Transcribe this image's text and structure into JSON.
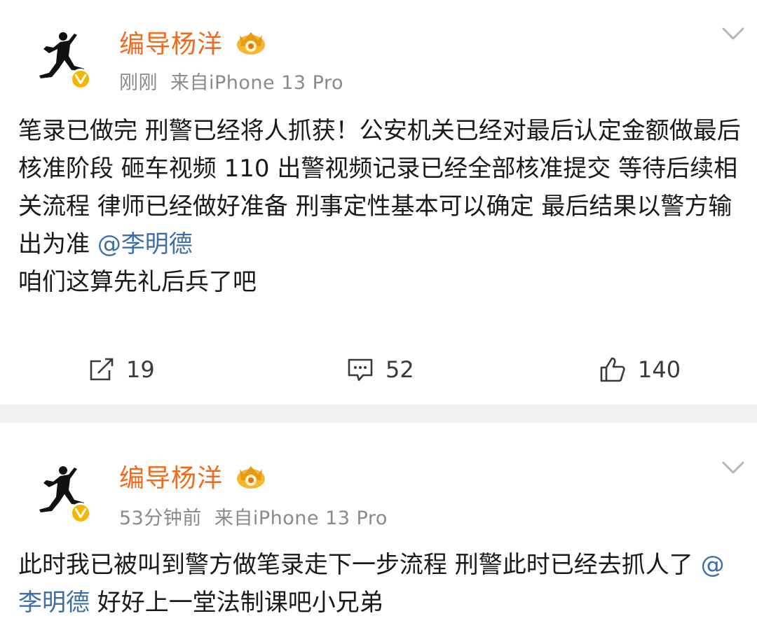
{
  "posts": [
    {
      "author": "编导杨洋",
      "time": "刚刚",
      "source": "来自iPhone 13 Pro",
      "content_before": "笔录已做完 刑警已经将人抓获！公安机关已经对最后认定金额做最后核准阶段 砸车视频 110 出警视频记录已经全部核准提交  等待后续相关流程 律师已经做好准备 刑事定性基本可以确定 最后结果以警方输出为准 ",
      "mention": "@李明德",
      "content_after": "咱们这算先礼后兵了吧",
      "repost_count": "19",
      "comment_count": "52",
      "like_count": "140"
    },
    {
      "author": "编导杨洋",
      "time": "53分钟前",
      "source": "来自iPhone 13 Pro",
      "content_before": "此时我已被叫到警方做笔录走下一步流程 刑警此时已经去抓人了 ",
      "mention": "@李明德",
      "content_after": " 好好上一堂法制课吧小兄弟"
    }
  ],
  "colors": {
    "username": "#f26a1b",
    "mention": "#3e6ea8",
    "verified_badge": "#f7b500",
    "meta": "#8a8a8a",
    "divider": "#f1f1f1"
  },
  "icons": {
    "avatar": "jumpman-logo-icon",
    "verified": "verified-v-icon",
    "crown": "vip-crown-icon",
    "menu": "chevron-down-icon",
    "repost": "repost-icon",
    "comment": "comment-icon",
    "like": "thumbs-up-icon"
  }
}
